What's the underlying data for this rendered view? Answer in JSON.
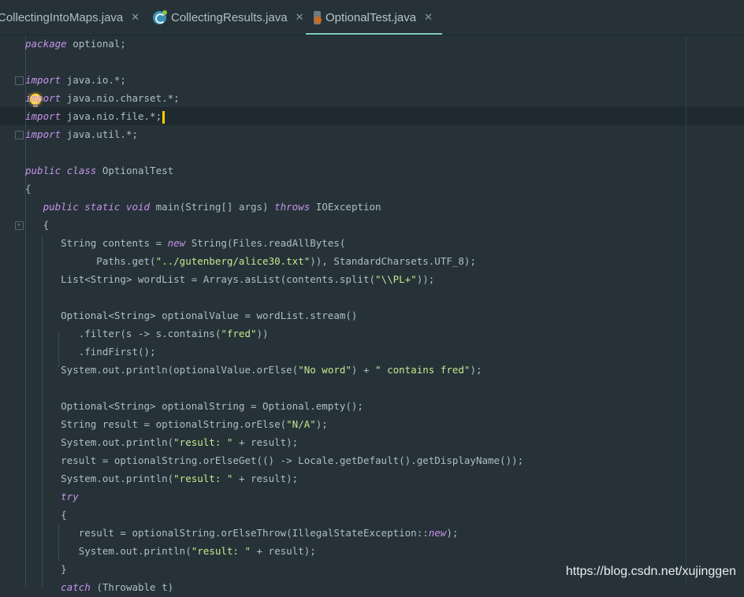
{
  "tabs": [
    {
      "label": "CollectingIntoMaps.java",
      "icon": "none",
      "active": false
    },
    {
      "label": "CollectingResults.java",
      "icon": "java-class-icon",
      "active": false
    },
    {
      "label": "OptionalTest.java",
      "icon": "java-file-icon",
      "active": true
    }
  ],
  "close_glyph": "✕",
  "code_lines": [
    [
      {
        "t": "package",
        "c": "kw"
      },
      {
        "t": " optional;"
      }
    ],
    [],
    [
      {
        "t": "import",
        "c": "kw"
      },
      {
        "t": " java.io.*;"
      }
    ],
    [
      {
        "t": "import",
        "c": "kw"
      },
      {
        "t": " java.nio.charset.*;"
      }
    ],
    [
      {
        "t": "import",
        "c": "kw"
      },
      {
        "t": " java.nio.file.*;"
      }
    ],
    [
      {
        "t": "import",
        "c": "kw"
      },
      {
        "t": " java.util.*;"
      }
    ],
    [],
    [
      {
        "t": "public",
        "c": "kw"
      },
      {
        "t": " "
      },
      {
        "t": "class",
        "c": "kw"
      },
      {
        "t": " OptionalTest"
      }
    ],
    [
      {
        "t": "{"
      }
    ],
    [
      {
        "t": "   "
      },
      {
        "t": "public",
        "c": "kw"
      },
      {
        "t": " "
      },
      {
        "t": "static",
        "c": "kw"
      },
      {
        "t": " "
      },
      {
        "t": "void",
        "c": "kw"
      },
      {
        "t": " main(String[] args) "
      },
      {
        "t": "throws",
        "c": "kw"
      },
      {
        "t": " IOException"
      }
    ],
    [
      {
        "t": "   {"
      }
    ],
    [
      {
        "t": "      String contents = "
      },
      {
        "t": "new",
        "c": "kw"
      },
      {
        "t": " String(Files.readAllBytes("
      }
    ],
    [
      {
        "t": "            Paths.get("
      },
      {
        "t": "\"../gutenberg/alice30.txt\"",
        "c": "str"
      },
      {
        "t": ")), StandardCharsets.UTF_8);"
      }
    ],
    [
      {
        "t": "      List<String> wordList = Arrays.asList(contents.split("
      },
      {
        "t": "\"\\\\PL+\"",
        "c": "str"
      },
      {
        "t": "));"
      }
    ],
    [],
    [
      {
        "t": "      Optional<String> optionalValue = wordList.stream()"
      }
    ],
    [
      {
        "t": "         .filter(s -> s.contains("
      },
      {
        "t": "\"fred\"",
        "c": "str"
      },
      {
        "t": "))"
      }
    ],
    [
      {
        "t": "         .findFirst();"
      }
    ],
    [
      {
        "t": "      System.out.println(optionalValue.orElse("
      },
      {
        "t": "\"No word\"",
        "c": "str"
      },
      {
        "t": ") + "
      },
      {
        "t": "\" contains fred\"",
        "c": "str"
      },
      {
        "t": ");"
      }
    ],
    [],
    [
      {
        "t": "      Optional<String> optionalString = Optional.empty();"
      }
    ],
    [
      {
        "t": "      String result = optionalString.orElse("
      },
      {
        "t": "\"N/A\"",
        "c": "str"
      },
      {
        "t": ");"
      }
    ],
    [
      {
        "t": "      System.out.println("
      },
      {
        "t": "\"result: \"",
        "c": "str"
      },
      {
        "t": " + result);"
      }
    ],
    [
      {
        "t": "      result = optionalString.orElseGet(() -> Locale.getDefault().getDisplayName());"
      }
    ],
    [
      {
        "t": "      System.out.println("
      },
      {
        "t": "\"result: \"",
        "c": "str"
      },
      {
        "t": " + result);"
      }
    ],
    [
      {
        "t": "      "
      },
      {
        "t": "try",
        "c": "kw"
      }
    ],
    [
      {
        "t": "      {"
      }
    ],
    [
      {
        "t": "         result = optionalString.orElseThrow(IllegalStateException::"
      },
      {
        "t": "new",
        "c": "kw"
      },
      {
        "t": ");"
      }
    ],
    [
      {
        "t": "         System.out.println("
      },
      {
        "t": "\"result: \"",
        "c": "str"
      },
      {
        "t": " + result);"
      }
    ],
    [
      {
        "t": "      }"
      }
    ],
    [
      {
        "t": "      "
      },
      {
        "t": "catch",
        "c": "kw"
      },
      {
        "t": " (Throwable t)"
      }
    ]
  ],
  "watermark": "https://blog.csdn.net/xujinggen"
}
